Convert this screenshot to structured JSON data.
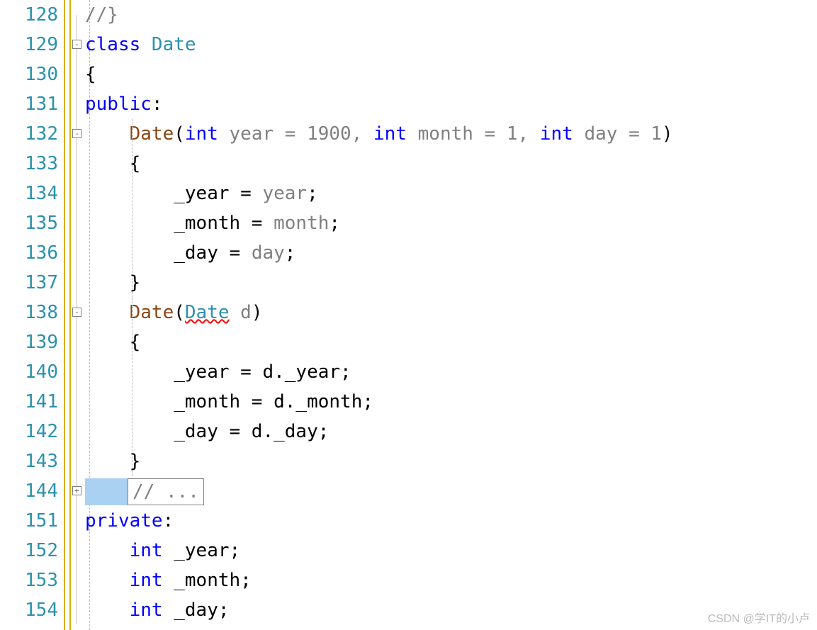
{
  "gutter": {
    "l0": "128",
    "l1": "129",
    "l2": "130",
    "l3": "131",
    "l4": "132",
    "l5": "133",
    "l6": "134",
    "l7": "135",
    "l8": "136",
    "l9": "137",
    "l10": "138",
    "l11": "139",
    "l12": "140",
    "l13": "141",
    "l14": "142",
    "l15": "143",
    "l16": "144",
    "l17": "151",
    "l18": "152",
    "l19": "153",
    "l20": "154"
  },
  "fold": {
    "minus": "-",
    "plus": "+"
  },
  "code": {
    "l0_commentend": "//}",
    "l1_kw_class": "class",
    "l1_type": " Date",
    "l2_brace": "{",
    "l3_kw": "public",
    "l3_colon": ":",
    "l4_indent": "    ",
    "l4_ctor": "Date",
    "l4_lp": "(",
    "l4_kw1": "int",
    "l4_p1": " year = 1900, ",
    "l4_kw2": "int",
    "l4_p2": " month = 1, ",
    "l4_kw3": "int",
    "l4_p3": " day = 1",
    "l4_rp": ")",
    "l5_indent": "    ",
    "l5_brace": "{",
    "l6_indent": "        ",
    "l6_lhs": "_year = ",
    "l6_rhs": "year",
    "l6_semi": ";",
    "l7_indent": "        ",
    "l7_lhs": "_month = ",
    "l7_rhs": "month",
    "l7_semi": ";",
    "l8_indent": "        ",
    "l8_lhs": "_day = ",
    "l8_rhs": "day",
    "l8_semi": ";",
    "l9_indent": "    ",
    "l9_brace": "}",
    "l10_indent": "    ",
    "l10_ctor": "Date",
    "l10_lp": "(",
    "l10_param_type": "Date",
    "l10_param_name": " d",
    "l10_rp": ")",
    "l11_indent": "    ",
    "l11_brace": "{",
    "l12_indent": "        ",
    "l12_txt": "_year = d._year;",
    "l13_indent": "        ",
    "l13_txt": "_month = d._month;",
    "l14_indent": "        ",
    "l14_txt": "_day = d._day;",
    "l15_indent": "    ",
    "l15_brace": "}",
    "l16_collapsed": "// ...",
    "l17_kw": "private",
    "l17_colon": ":",
    "l18_indent": "    ",
    "l18_kw": "int",
    "l18_name": " _year;",
    "l19_indent": "    ",
    "l19_kw": "int",
    "l19_name": " _month;",
    "l20_indent": "    ",
    "l20_kw": "int",
    "l20_name": " _day;"
  },
  "watermark": "CSDN @学IT的小卢"
}
